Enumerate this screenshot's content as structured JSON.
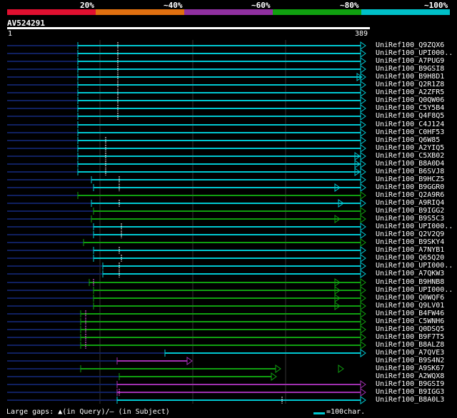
{
  "header": {
    "pct_labels": [
      "20%",
      "~40%",
      "~60%",
      "~80%",
      "~100%"
    ],
    "band_colors": [
      "#e01030",
      "#e07010",
      "#9030a0",
      "#10a010",
      "#00c0c8"
    ]
  },
  "query": {
    "id": "AV524291",
    "start": "1",
    "end": "389"
  },
  "colors": {
    "cyan": "#00c8d2",
    "green": "#10a010",
    "purple": "#a030b0",
    "navy": "#102060",
    "pink": "#ff60ff"
  },
  "hits": [
    {
      "label": "UniRef100_Q9ZQX6",
      "color": "cyan"
    },
    {
      "label": "UniRef100_UPI000..",
      "color": "cyan"
    },
    {
      "label": "UniRef100_A7PUG9",
      "color": "cyan"
    },
    {
      "label": "UniRef100_B9GSI8",
      "color": "cyan"
    },
    {
      "label": "UniRef100_B9H8D1",
      "color": "cyan"
    },
    {
      "label": "UniRef100_Q2R1Z8",
      "color": "cyan"
    },
    {
      "label": "UniRef100_A2ZFR5",
      "color": "cyan"
    },
    {
      "label": "UniRef100_Q0QW06",
      "color": "cyan"
    },
    {
      "label": "UniRef100_C5Y5B4",
      "color": "cyan"
    },
    {
      "label": "UniRef100_Q4F8Q5",
      "color": "cyan"
    },
    {
      "label": "UniRef100_C4J124",
      "color": "cyan"
    },
    {
      "label": "UniRef100_C0HF53",
      "color": "cyan"
    },
    {
      "label": "UniRef100_Q6W85",
      "color": "cyan"
    },
    {
      "label": "UniRef100_A2YIQ5",
      "color": "cyan"
    },
    {
      "label": "UniRef100_C5XB02",
      "color": "cyan"
    },
    {
      "label": "UniRef100_B8A0D4",
      "color": "cyan"
    },
    {
      "label": "UniRef100_B6SVJ8",
      "color": "cyan"
    },
    {
      "label": "UniRef100_B9HCZ5",
      "color": "cyan"
    },
    {
      "label": "UniRef100_B9GGR0",
      "color": "cyan"
    },
    {
      "label": "UniRef100_Q2A9R6",
      "color": "green"
    },
    {
      "label": "UniRef100_A9RIQ4",
      "color": "cyan"
    },
    {
      "label": "UniRef100_B9IGG2",
      "color": "green"
    },
    {
      "label": "UniRef100_B9S5C3",
      "color": "green"
    },
    {
      "label": "UniRef100_UPI000..",
      "color": "cyan"
    },
    {
      "label": "UniRef100_Q2V2Q9",
      "color": "cyan"
    },
    {
      "label": "UniRef100_B9SKY4",
      "color": "green"
    },
    {
      "label": "UniRef100_A7NYB1",
      "color": "cyan"
    },
    {
      "label": "UniRef100_Q65Q20",
      "color": "cyan"
    },
    {
      "label": "UniRef100_UPI000..",
      "color": "cyan"
    },
    {
      "label": "UniRef100_A7QKW3",
      "color": "cyan"
    },
    {
      "label": "UniRef100_B9HNB8",
      "color": "green"
    },
    {
      "label": "UniRef100_UPI000..",
      "color": "green"
    },
    {
      "label": "UniRef100_Q0WQF6",
      "color": "green"
    },
    {
      "label": "UniRef100_Q9LV01",
      "color": "green"
    },
    {
      "label": "UniRef100_B4FW46",
      "color": "green"
    },
    {
      "label": "UniRef100_C5WNH6",
      "color": "green"
    },
    {
      "label": "UniRef100_Q0DSQ5",
      "color": "green"
    },
    {
      "label": "UniRef100_B9F7T5",
      "color": "green"
    },
    {
      "label": "UniRef100_B8ALZ8",
      "color": "green"
    },
    {
      "label": "UniRef100_A7QVE3",
      "color": "cyan"
    },
    {
      "label": "UniRef100_B9S4N2",
      "color": "purple"
    },
    {
      "label": "UniRef100_A9SK67",
      "color": "green"
    },
    {
      "label": "UniRef100_A2WQX8",
      "color": "green"
    },
    {
      "label": "UniRef100_B9GSI9",
      "color": "purple"
    },
    {
      "label": "UniRef100_B9IGG3",
      "color": "purple"
    },
    {
      "label": "UniRef100_B8A0L3",
      "color": "cyan"
    }
  ],
  "footer": {
    "gaps_text": "Large gaps: ▲(in Query)/– (in Subject)",
    "scale_text": "=100char."
  }
}
